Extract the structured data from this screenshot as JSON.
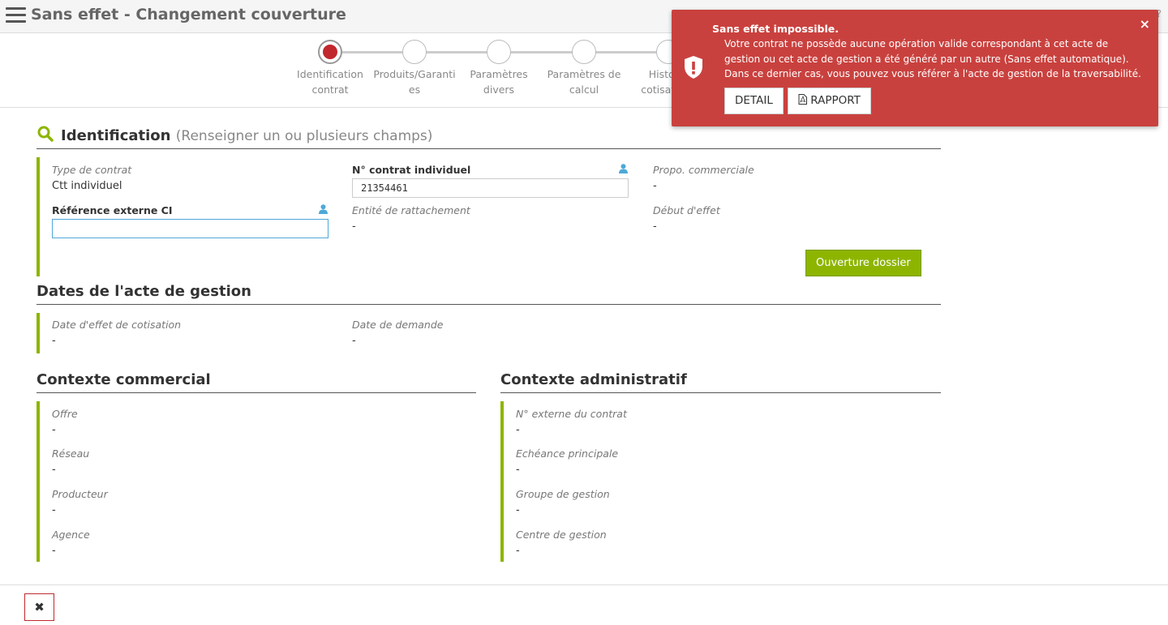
{
  "header": {
    "title": "Sans effet - Changement couverture"
  },
  "stepper": {
    "steps": [
      {
        "label_line1": "Identification",
        "label_line2": "contrat"
      },
      {
        "label_line1": "Produits/Garanti",
        "label_line2": "es"
      },
      {
        "label_line1": "Paramètres",
        "label_line2": "divers"
      },
      {
        "label_line1": "Paramètres de",
        "label_line2": "calcul"
      },
      {
        "label_line1": "Historiq",
        "label_line2": "cotisations"
      }
    ]
  },
  "identification": {
    "title": "Identification",
    "subtitle": "(Renseigner un ou plusieurs champs)",
    "type_contrat_label": "Type de contrat",
    "type_contrat_value": "Ctt individuel",
    "num_contrat_label": "N° contrat individuel",
    "num_contrat_value": "21354461",
    "propo_label": "Propo. commerciale",
    "propo_value": "-",
    "ref_externe_label": "Référence externe CI",
    "ref_externe_value": "",
    "entite_label": "Entité de rattachement",
    "entite_value": "-",
    "debut_label": "Début d'effet",
    "debut_value": "-",
    "open_button": "Ouverture dossier"
  },
  "dates": {
    "title": "Dates de l'acte de gestion",
    "effet_label": "Date d'effet de cotisation",
    "effet_value": "-",
    "demande_label": "Date de demande",
    "demande_value": "-"
  },
  "commercial": {
    "title": "Contexte commercial",
    "fields": [
      {
        "label": "Offre",
        "value": "-"
      },
      {
        "label": "Réseau",
        "value": "-"
      },
      {
        "label": "Producteur",
        "value": "-"
      },
      {
        "label": "Agence",
        "value": "-"
      }
    ]
  },
  "administratif": {
    "title": "Contexte administratif",
    "fields": [
      {
        "label": "N° externe du contrat",
        "value": "-"
      },
      {
        "label": "Echéance principale",
        "value": "-"
      },
      {
        "label": "Groupe de gestion",
        "value": "-"
      },
      {
        "label": "Centre de gestion",
        "value": "-"
      }
    ]
  },
  "toast": {
    "title": "Sans effet impossible.",
    "line1": "Votre contrat ne possède aucune opération valide correspondant à cet acte de",
    "line2": "gestion ou cet acte de gestion a été généré par un autre (Sans effet automatique).",
    "line3": "Dans ce dernier cas, vous pouvez vous référer à l'acte de gestion de la traversabilité.",
    "detail_button": "DETAIL",
    "rapport_button": "RAPPORT"
  },
  "colors": {
    "accent": "#8db500",
    "error": "#c9413e",
    "active_step": "#c0282d"
  }
}
